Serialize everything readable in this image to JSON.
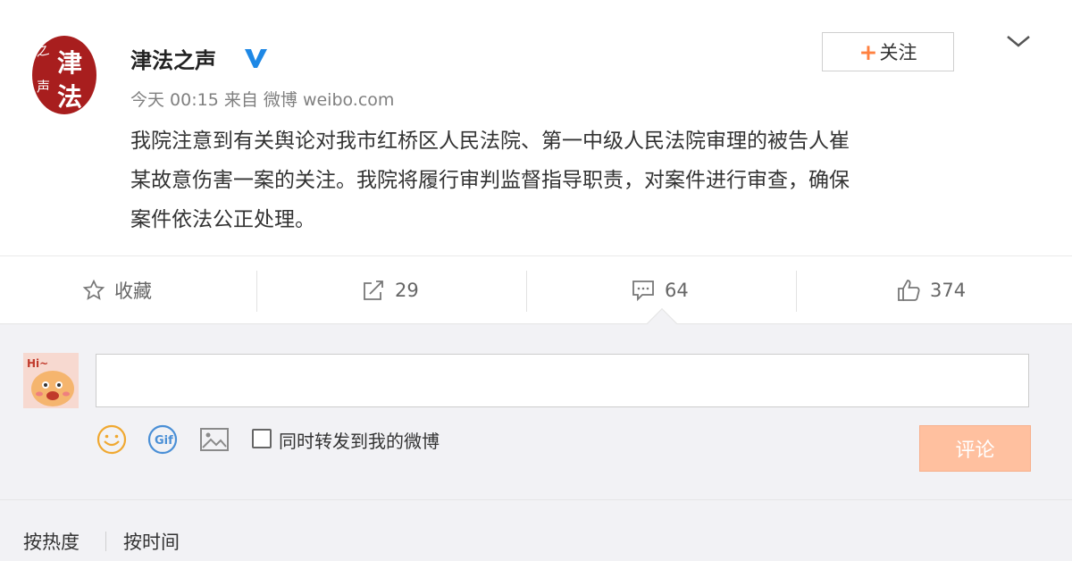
{
  "post": {
    "author": "津法之声",
    "verified_icon": "verified-v-icon",
    "avatar_text": [
      "之",
      "声",
      "津",
      "法"
    ],
    "time": "今天 00:15",
    "source_prefix": "来自",
    "source": "微博 weibo.com",
    "content_lines": [
      "我院注意到有关舆论对我市红桥区人民法院、第一中级人民法院审理的被告人崔",
      "某故意伤害一案的关注。我院将履行审判监督指导职责，对案件进行审查，确保",
      "案件依法公正处理。"
    ],
    "follow": {
      "plus": "+",
      "label": "关注"
    }
  },
  "actions": {
    "favorite": {
      "icon": "star-icon",
      "label": "收藏"
    },
    "repost": {
      "icon": "share-icon",
      "count": "29"
    },
    "comment": {
      "icon": "comment-icon",
      "count": "64"
    },
    "like": {
      "icon": "thumbs-up-icon",
      "count": "374"
    }
  },
  "comment_box": {
    "avatar_text": "Hi~",
    "input_value": "",
    "tools": [
      "smile-emoji-icon",
      "gif-icon",
      "image-icon"
    ],
    "also_repost_label": "同时转发到我的微博",
    "submit_label": "评论"
  },
  "sort": {
    "hot": "按热度",
    "time": "按时间"
  },
  "colors": {
    "accent": "#ff8140",
    "submit_bg": "#ffc09f",
    "verified": "#1e88e5",
    "avatar_red": "#a81e1e"
  }
}
